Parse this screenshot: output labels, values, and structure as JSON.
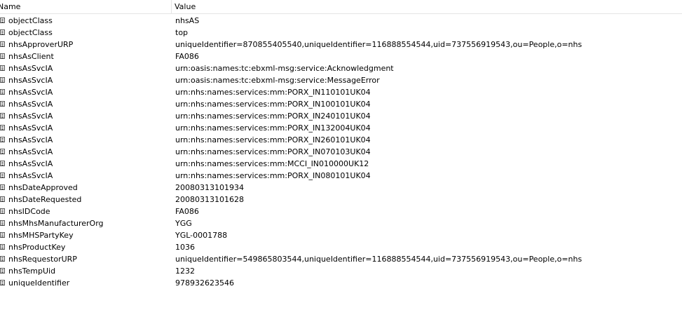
{
  "columns": {
    "name": "Name",
    "value": "Value"
  },
  "rows": [
    {
      "name": "objectClass",
      "value": "nhsAS"
    },
    {
      "name": "objectClass",
      "value": "top"
    },
    {
      "name": "nhsApproverURP",
      "value": "uniqueIdentifier=870855405540,uniqueIdentifier=116888554544,uid=737556919543,ou=People,o=nhs"
    },
    {
      "name": "nhsAsClient",
      "value": "FA086"
    },
    {
      "name": "nhsAsSvcIA",
      "value": "urn:oasis:names:tc:ebxml-msg:service:Acknowledgment"
    },
    {
      "name": "nhsAsSvcIA",
      "value": "urn:oasis:names:tc:ebxml-msg:service:MessageError"
    },
    {
      "name": "nhsAsSvcIA",
      "value": "urn:nhs:names:services:mm:PORX_IN110101UK04"
    },
    {
      "name": "nhsAsSvcIA",
      "value": "urn:nhs:names:services:mm:PORX_IN100101UK04"
    },
    {
      "name": "nhsAsSvcIA",
      "value": "urn:nhs:names:services:mm:PORX_IN240101UK04"
    },
    {
      "name": "nhsAsSvcIA",
      "value": "urn:nhs:names:services:mm:PORX_IN132004UK04"
    },
    {
      "name": "nhsAsSvcIA",
      "value": "urn:nhs:names:services:mm:PORX_IN260101UK04"
    },
    {
      "name": "nhsAsSvcIA",
      "value": "urn:nhs:names:services:mm:PORX_IN070103UK04"
    },
    {
      "name": "nhsAsSvcIA",
      "value": "urn:nhs:names:services:mm:MCCI_IN010000UK12"
    },
    {
      "name": "nhsAsSvcIA",
      "value": "urn:nhs:names:services:mm:PORX_IN080101UK04"
    },
    {
      "name": "nhsDateApproved",
      "value": "20080313101934"
    },
    {
      "name": "nhsDateRequested",
      "value": "20080313101628"
    },
    {
      "name": "nhsIDCode",
      "value": "FA086"
    },
    {
      "name": "nhsMhsManufacturerOrg",
      "value": "YGG"
    },
    {
      "name": "nhsMHSPartyKey",
      "value": "YGL-0001788"
    },
    {
      "name": "nhsProductKey",
      "value": "1036"
    },
    {
      "name": "nhsRequestorURP",
      "value": "uniqueIdentifier=549865803544,uniqueIdentifier=116888554544,uid=737556919543,ou=People,o=nhs"
    },
    {
      "name": "nhsTempUid",
      "value": "1232"
    },
    {
      "name": "uniqueIdentifier",
      "value": "978932623546"
    }
  ],
  "icons": {
    "row_icon": "attribute-icon"
  }
}
